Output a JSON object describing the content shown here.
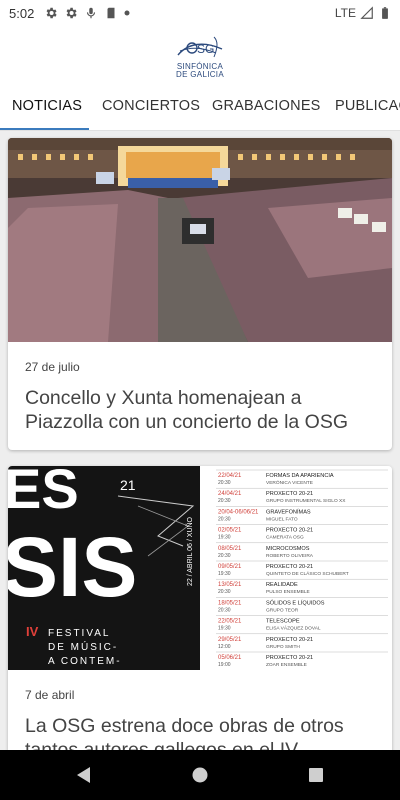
{
  "status_bar": {
    "time": "5:02",
    "left_icons": [
      "settings-icon",
      "settings-icon",
      "microphone-icon",
      "sd-card-icon",
      "dot-icon"
    ],
    "network": "LTE",
    "right_icons": [
      "signal-icon",
      "battery-icon"
    ]
  },
  "header": {
    "logo_line1": "SINFÓNICA",
    "logo_line2": "DE GALICIA",
    "brand_color": "#2c4a7d"
  },
  "tabs": [
    {
      "label": "NOTICIAS",
      "active": true
    },
    {
      "label": "CONCIERTOS",
      "active": false
    },
    {
      "label": "GRABACIONES",
      "active": false
    },
    {
      "label": "PUBLICACIONES",
      "active": false
    }
  ],
  "accent_color": "#3b7bbd",
  "news": [
    {
      "date": "27 de julio",
      "title": "Concello y Xunta homenajean a Piazzolla con un concierto de la OSG"
    },
    {
      "date": "7 de abril",
      "title": "La OSG estrena doce obras de otros tantos autores gallegos en el IV",
      "poster": {
        "big_text": "ESIS",
        "year_mark": "21",
        "side_text": "22 / ABRIL 06 / XUÑO",
        "festival_edition": "IV",
        "festival_line1": "FESTIVAL",
        "festival_line2": "DE MÚSIC-",
        "festival_line3": "A CONTEM-",
        "schedule": [
          {
            "date": "22/04/21",
            "time": "20:30",
            "title": "FORMAS DA APARIENCIA",
            "sub": "VERÓNICA VICENTE"
          },
          {
            "date": "24/04/21",
            "time": "20:30",
            "title": "PROXECTO 20-21",
            "sub": "GRUPO INSTRUMENTAL SIGLO XX"
          },
          {
            "date": "20/04-06/06/21",
            "time": "20:30",
            "title": "GRAVEFONÍMAS",
            "sub": "MIGUEL FATO"
          },
          {
            "date": "02/05/21",
            "time": "19:30",
            "title": "PROXECTO 20-21",
            "sub": "CAMERATA OSG"
          },
          {
            "date": "08/05/21",
            "time": "20:30",
            "title": "MICROCOSMOS",
            "sub": "ROBERTO OLIVEIRA"
          },
          {
            "date": "09/05/21",
            "time": "19:30",
            "title": "PROXECTO 20-21",
            "sub": "QUINTETO DE CLÁSICO SCHUBERT"
          },
          {
            "date": "13/05/21",
            "time": "20:30",
            "title": "REALIDADE",
            "sub": "PULSO ENSEMBLE"
          },
          {
            "date": "18/05/21",
            "time": "20:30",
            "title": "SÓLIDOS E LÍQUIDOS",
            "sub": "GRUPO TEOR"
          },
          {
            "date": "22/05/21",
            "time": "19:30",
            "title": "TELESCOPE",
            "sub": "ELISA VÁZQUEZ DOVAL"
          },
          {
            "date": "29/05/21",
            "time": "12:00",
            "title": "PROXECTO 20-21",
            "sub": "GRUPO SMITH"
          },
          {
            "date": "05/06/21",
            "time": "19:00",
            "title": "PROXECTO 20-21",
            "sub": "ZOAR ENSEMBLE"
          }
        ]
      }
    }
  ],
  "nav": [
    "back-icon",
    "home-icon",
    "recents-icon"
  ]
}
